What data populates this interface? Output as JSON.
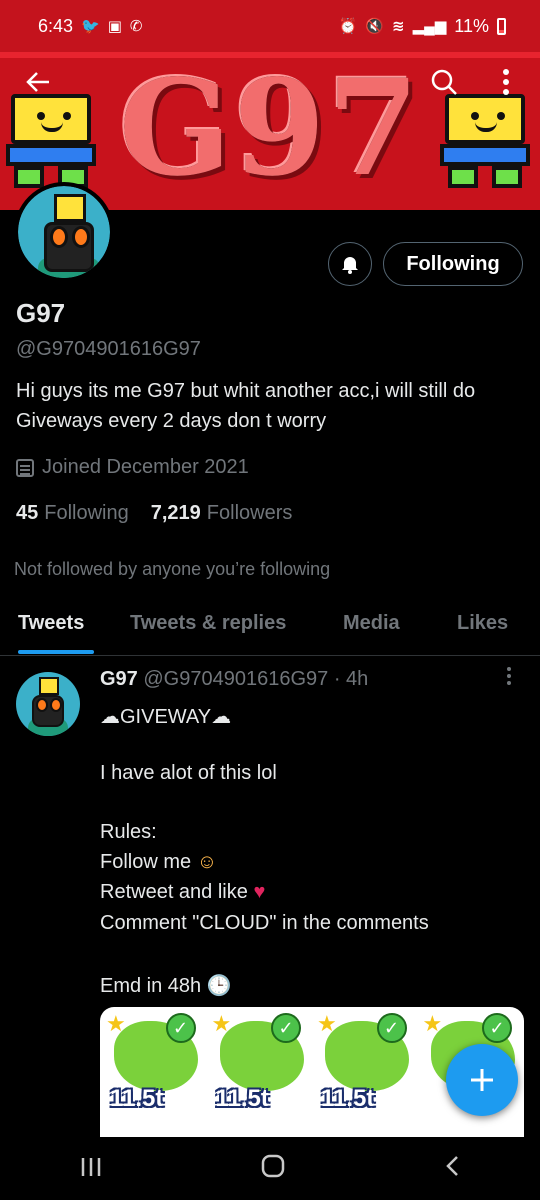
{
  "status_bar": {
    "time": "6:43",
    "battery": "11%"
  },
  "banner": {
    "text": "G97"
  },
  "profile": {
    "name": "G97",
    "handle": "@G9704901616G97",
    "bio": "Hi guys its me G97 but whit another acc,i will still do Giveways every 2 days don t worry",
    "joined": "Joined December 2021",
    "following_count": "45",
    "following_label": "Following",
    "followers_count": "7,219",
    "followers_label": "Followers",
    "not_followed": "Not followed by anyone you’re following",
    "following_button": "Following"
  },
  "tabs": [
    "Tweets",
    "Tweets & replies",
    "Media",
    "Likes"
  ],
  "tweet": {
    "name": "G97",
    "meta": "@G9704901616G97 · 4h",
    "title": "GIVEWAY",
    "lines": [
      "I have alot of this lol",
      "Rules:",
      "Follow me",
      "Retweet and like",
      "Comment \"CLOUD\" in the comments",
      "Emd in 48h"
    ],
    "pet_label": "11.5t"
  },
  "icons": {
    "back": "arrow-left-icon",
    "search": "search-icon",
    "more": "more-vertical-icon",
    "bell": "bell-icon",
    "compose": "plus-icon"
  },
  "colors": {
    "accent": "#1d9bf0",
    "banner": "#c8121c",
    "muted": "#71767b"
  }
}
